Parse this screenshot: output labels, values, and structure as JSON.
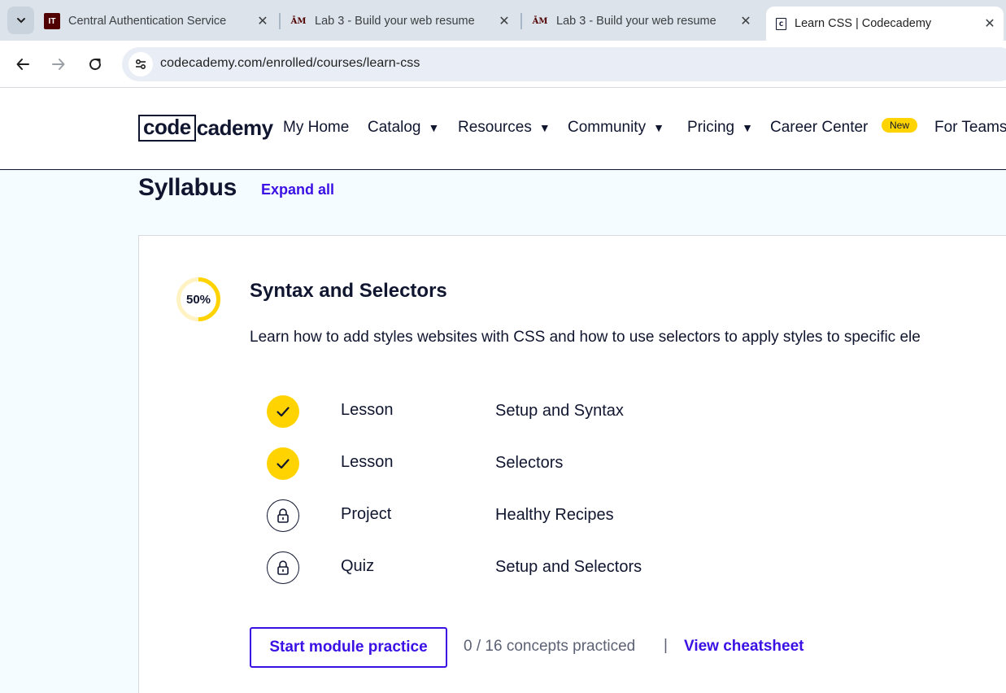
{
  "browser": {
    "tabs": [
      {
        "title": "Central Authentication Service",
        "favicon": "IT",
        "active": false
      },
      {
        "title": "Lab 3 - Build your web resume",
        "favicon": "ATM",
        "active": false
      },
      {
        "title": "Lab 3 - Build your web resume",
        "favicon": "ATM",
        "active": false
      },
      {
        "title": "Learn CSS | Codecademy",
        "favicon": "c_",
        "active": true
      }
    ],
    "url": "codecademy.com/enrolled/courses/learn-css"
  },
  "header": {
    "logo": {
      "boxed": "code",
      "rest": "cademy"
    },
    "nav": [
      {
        "label": "My Home",
        "has_caret": false
      },
      {
        "label": "Catalog",
        "has_caret": true
      },
      {
        "label": "Resources",
        "has_caret": true
      },
      {
        "label": "Community",
        "has_caret": true
      },
      {
        "label": "Pricing",
        "has_caret": true
      },
      {
        "label": "Career Center",
        "has_caret": false
      },
      {
        "label": "For Teams",
        "has_caret": false
      }
    ],
    "new_badge": "New"
  },
  "syllabus": {
    "title": "Syllabus",
    "expand_all": "Expand all"
  },
  "module": {
    "progress_percent": 50,
    "progress_label": "50%",
    "title": "Syntax and Selectors",
    "description": "Learn how to add styles websites with CSS and how to use selectors to apply styles to specific ele",
    "items": [
      {
        "type": "Lesson",
        "name": "Setup and Syntax",
        "status": "completed"
      },
      {
        "type": "Lesson",
        "name": "Selectors",
        "status": "completed"
      },
      {
        "type": "Project",
        "name": "Healthy Recipes",
        "status": "locked"
      },
      {
        "type": "Quiz",
        "name": "Setup and Selectors",
        "status": "locked"
      }
    ],
    "practice_button": "Start module practice",
    "concepts_text": "0 / 16 concepts practiced",
    "separator": "|",
    "cheatsheet_link": "View cheatsheet"
  },
  "colors": {
    "accent": "#3a10e5",
    "completed": "#ffd300",
    "navy": "#10162f",
    "page_bg": "#f5fcff"
  }
}
